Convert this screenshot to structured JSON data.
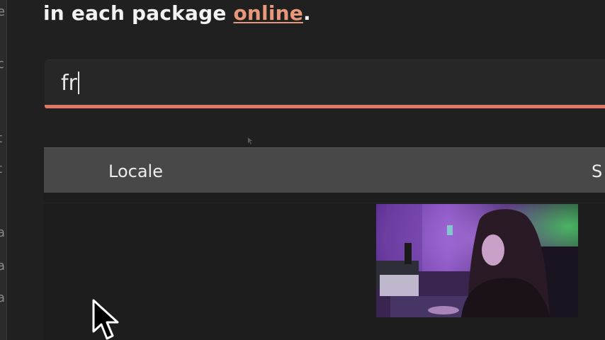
{
  "intro": {
    "text_before": "in each package ",
    "link_text": "online",
    "text_after": "."
  },
  "search": {
    "value": "fr"
  },
  "table": {
    "headers": [
      "Locale",
      "S"
    ]
  },
  "colors": {
    "background": "#202020",
    "accent": "#e07760",
    "link": "#e8987a",
    "header_bg": "#484848",
    "text": "#f2f2f2"
  },
  "icons": [
    "mouse-pointer-icon"
  ]
}
